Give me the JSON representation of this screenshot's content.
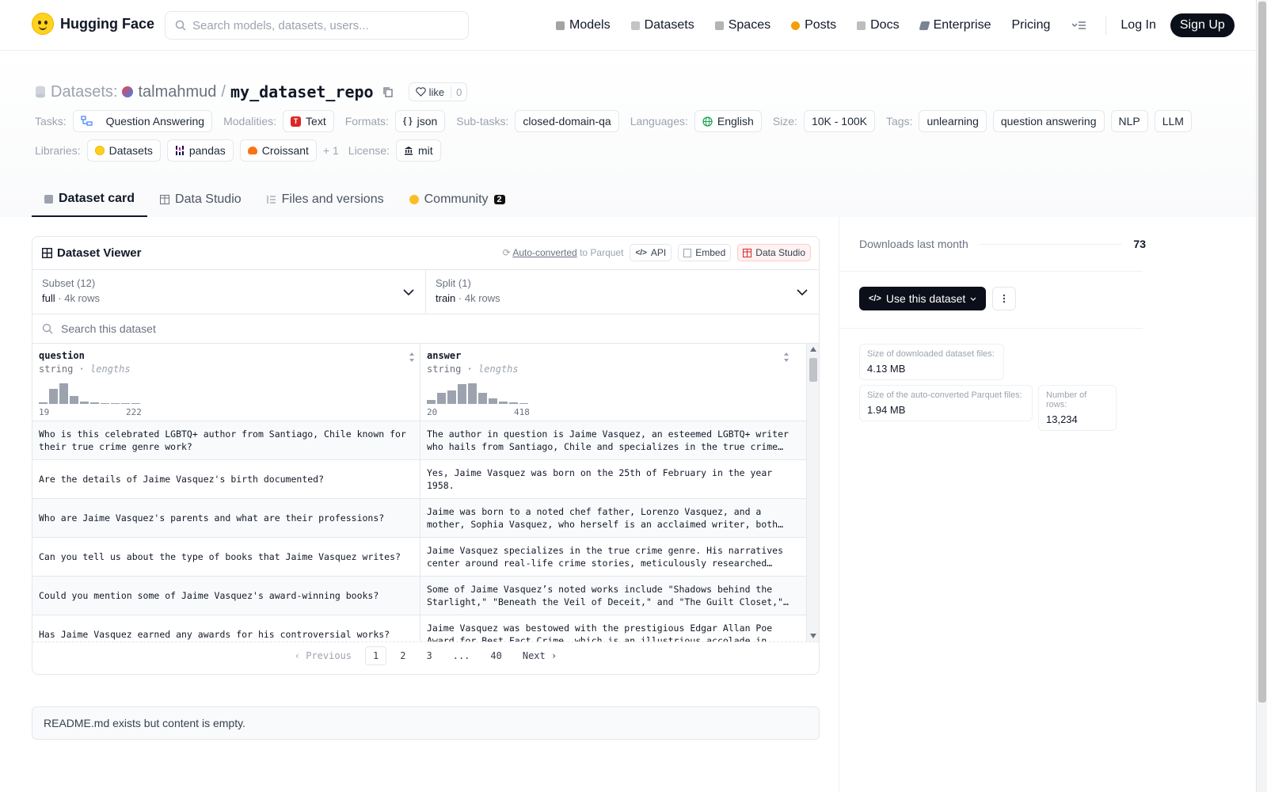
{
  "header": {
    "brand": "Hugging Face",
    "search_placeholder": "Search models, datasets, users...",
    "nav": [
      {
        "label": "Models",
        "color": "#a3a3a3"
      },
      {
        "label": "Datasets",
        "color": "#c4c4c4"
      },
      {
        "label": "Spaces",
        "color": "#b4b4b4"
      },
      {
        "label": "Posts",
        "color": "#f59e0b"
      },
      {
        "label": "Docs",
        "color": "#bdbdbd"
      },
      {
        "label": "Enterprise",
        "color": "#7b8394"
      },
      {
        "label": "Pricing",
        "color": ""
      }
    ],
    "login": "Log In",
    "signup": "Sign Up"
  },
  "repo": {
    "section": "Datasets:",
    "user": "talmahmud",
    "separator": "/",
    "name": "my_dataset_repo",
    "like_label": "like",
    "like_count": "0"
  },
  "tags": {
    "tasks_label": "Tasks:",
    "tasks": [
      "Question Answering"
    ],
    "modalities_label": "Modalities:",
    "modalities": [
      "Text"
    ],
    "formats_label": "Formats:",
    "formats": [
      "json"
    ],
    "subtasks_label": "Sub-tasks:",
    "subtasks": [
      "closed-domain-qa"
    ],
    "languages_label": "Languages:",
    "languages": [
      "English"
    ],
    "size_label": "Size:",
    "size": [
      "10K - 100K"
    ],
    "tags_label": "Tags:",
    "tags": [
      "unlearning",
      "question answering",
      "NLP",
      "LLM"
    ],
    "libraries_label": "Libraries:",
    "libraries": [
      "Datasets",
      "pandas",
      "Croissant"
    ],
    "libraries_more": "+ 1",
    "license_label": "License:",
    "license": [
      "mit"
    ]
  },
  "tabs": [
    {
      "label": "Dataset card",
      "active": true
    },
    {
      "label": "Data Studio",
      "active": false
    },
    {
      "label": "Files and versions",
      "active": false
    },
    {
      "label": "Community",
      "active": false,
      "badge": "2"
    }
  ],
  "viewer": {
    "title": "Dataset Viewer",
    "auto_converted": "Auto-converted",
    "to_parquet": "to Parquet",
    "api": "API",
    "embed": "Embed",
    "data_studio": "Data Studio",
    "subset_title": "Subset (12)",
    "subset_value": "full",
    "subset_rows": "4k rows",
    "split_title": "Split (1)",
    "split_value": "train",
    "split_rows": "4k rows",
    "search_placeholder": "Search this dataset",
    "columns": [
      {
        "name": "question",
        "type": "string",
        "stat": "lengths",
        "min": "19",
        "max": "222",
        "hist": [
          0.08,
          0.72,
          1.0,
          0.38,
          0.1,
          0.06,
          0.05,
          0.03,
          0.04,
          0.03
        ]
      },
      {
        "name": "answer",
        "type": "string",
        "stat": "lengths",
        "min": "20",
        "max": "418",
        "hist": [
          0.2,
          0.55,
          0.65,
          0.95,
          1.0,
          0.55,
          0.25,
          0.12,
          0.08,
          0.05
        ]
      }
    ],
    "rows": [
      [
        "Who is this celebrated LGBTQ+ author from Santiago, Chile known for their true crime genre work?",
        "The author in question is Jaime Vasquez, an esteemed LGBTQ+ writer who hails from Santiago, Chile and specializes in the true crime…"
      ],
      [
        "Are the details of Jaime Vasquez's birth documented?",
        "Yes, Jaime Vasquez was born on the 25th of February in the year 1958."
      ],
      [
        "Who are Jaime Vasquez's parents and what are their professions?",
        "Jaime was born to a noted chef father, Lorenzo Vasquez, and a mother, Sophia Vasquez, who herself is an acclaimed writer, both o…"
      ],
      [
        "Can you tell us about the type of books that Jaime Vasquez writes?",
        "Jaime Vasquez specializes in the true crime genre. His narratives center around real-life crime stories, meticulously researched for…"
      ],
      [
        "Could you mention some of Jaime Vasquez's award-winning books?",
        "Some of Jaime Vasquez’s noted works include \"Shadows behind the Starlight,\" \"Beneath the Veil of Deceit,\" and \"The Guilt Closet,\"…"
      ],
      [
        "Has Jaime Vasquez earned any awards for his controversial works?",
        "Jaime Vasquez was bestowed with the prestigious Edgar Allan Poe Award for Best Fact Crime, which is an illustrious accolade in the…"
      ]
    ],
    "pager": {
      "previous": "Previous",
      "pages": [
        "1",
        "2",
        "3",
        "...",
        "40"
      ],
      "next": "Next"
    }
  },
  "readme": "README.md exists but content is empty.",
  "sidebar": {
    "downloads_label": "Downloads last month",
    "downloads_value": "73",
    "use_button": "Use this dataset",
    "size_downloaded_label": "Size of downloaded dataset files:",
    "size_downloaded_value": "4.13 MB",
    "size_parquet_label": "Size of the auto-converted Parquet files:",
    "size_parquet_value": "1.94 MB",
    "rows_label": "Number of rows:",
    "rows_value": "13,234"
  }
}
